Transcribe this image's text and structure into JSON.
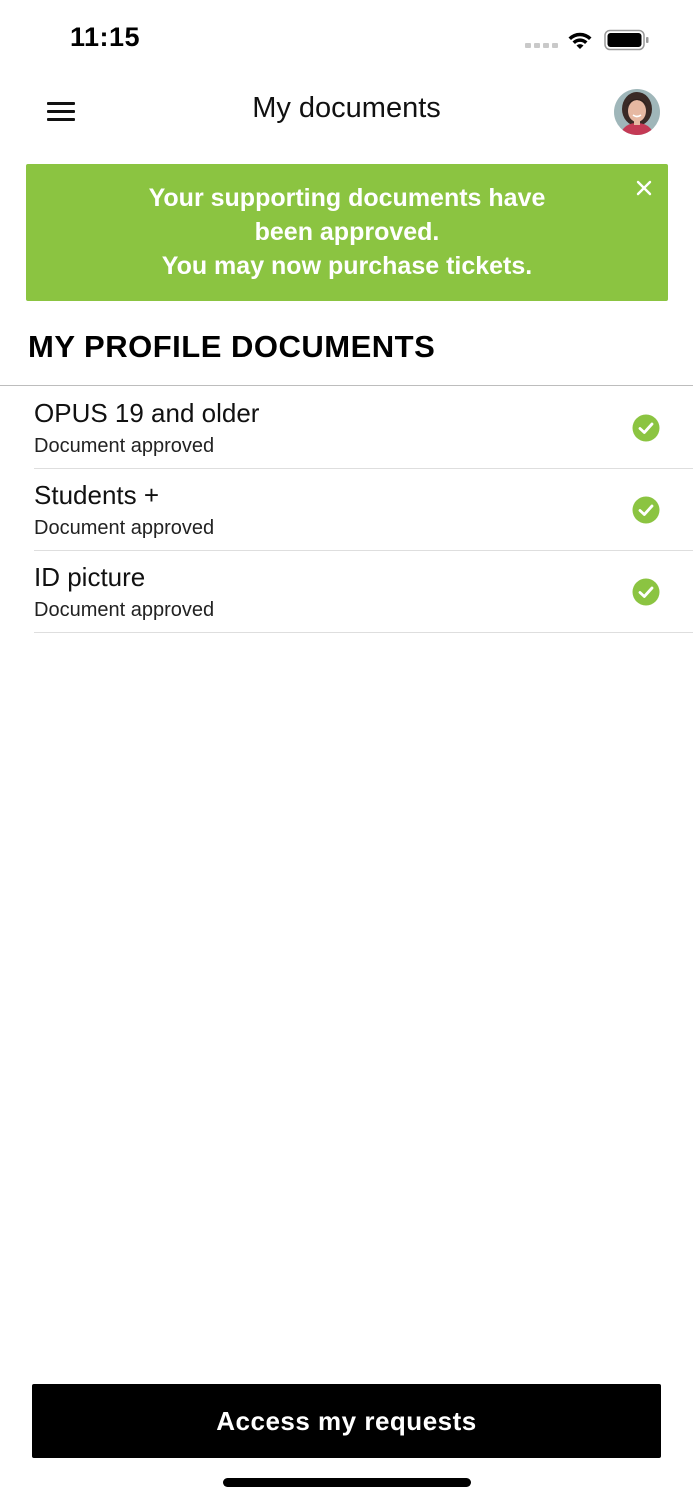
{
  "status_bar": {
    "time": "11:15"
  },
  "header": {
    "title": "My documents",
    "menu_icon": "hamburger-menu-icon",
    "avatar_icon": "user-avatar"
  },
  "banner": {
    "lines": [
      "Your supporting documents have",
      "been approved.",
      "You may now purchase tickets."
    ],
    "close_icon": "close-icon",
    "background_color": "#8bc441"
  },
  "section": {
    "heading": "MY PROFILE DOCUMENTS"
  },
  "documents": [
    {
      "title": "OPUS 19 and older",
      "status": "Document approved",
      "icon": "check-circle-icon"
    },
    {
      "title": "Students +",
      "status": "Document approved",
      "icon": "check-circle-icon"
    },
    {
      "title": "ID picture",
      "status": "Document approved",
      "icon": "check-circle-icon"
    }
  ],
  "colors": {
    "accent_green": "#8bc441",
    "button_bg": "#000000"
  },
  "footer": {
    "button_label": "Access my requests"
  }
}
